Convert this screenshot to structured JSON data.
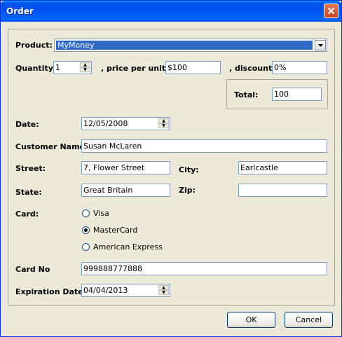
{
  "window": {
    "title": "Order"
  },
  "product": {
    "label": "Product:",
    "value": "MyMoney"
  },
  "quantity": {
    "label": "Quantity:",
    "value": "1"
  },
  "price": {
    "label": ", price per unit:",
    "value": "$100"
  },
  "discount": {
    "label": ", discount:",
    "value": "0%"
  },
  "total": {
    "label": "Total:",
    "value": "100"
  },
  "date": {
    "label": "Date:",
    "value": "12/05/2008"
  },
  "customer": {
    "label": "Customer Name:",
    "value": "Susan McLaren"
  },
  "street": {
    "label": "Street:",
    "value": "7, Flower Street"
  },
  "city": {
    "label": "City:",
    "value": "Earlcastle"
  },
  "state": {
    "label": "State:",
    "value": "Great Britain"
  },
  "zip": {
    "label": "Zip:",
    "value": ""
  },
  "card": {
    "label": "Card:",
    "options": [
      "Visa",
      "MasterCard",
      "American Express"
    ],
    "selected": "MasterCard"
  },
  "card_no": {
    "label": "Card No",
    "value": "999888777888"
  },
  "expiration": {
    "label": "Expiration Date:",
    "value": "04/04/2013"
  },
  "buttons": {
    "ok": "OK",
    "cancel": "Cancel"
  }
}
